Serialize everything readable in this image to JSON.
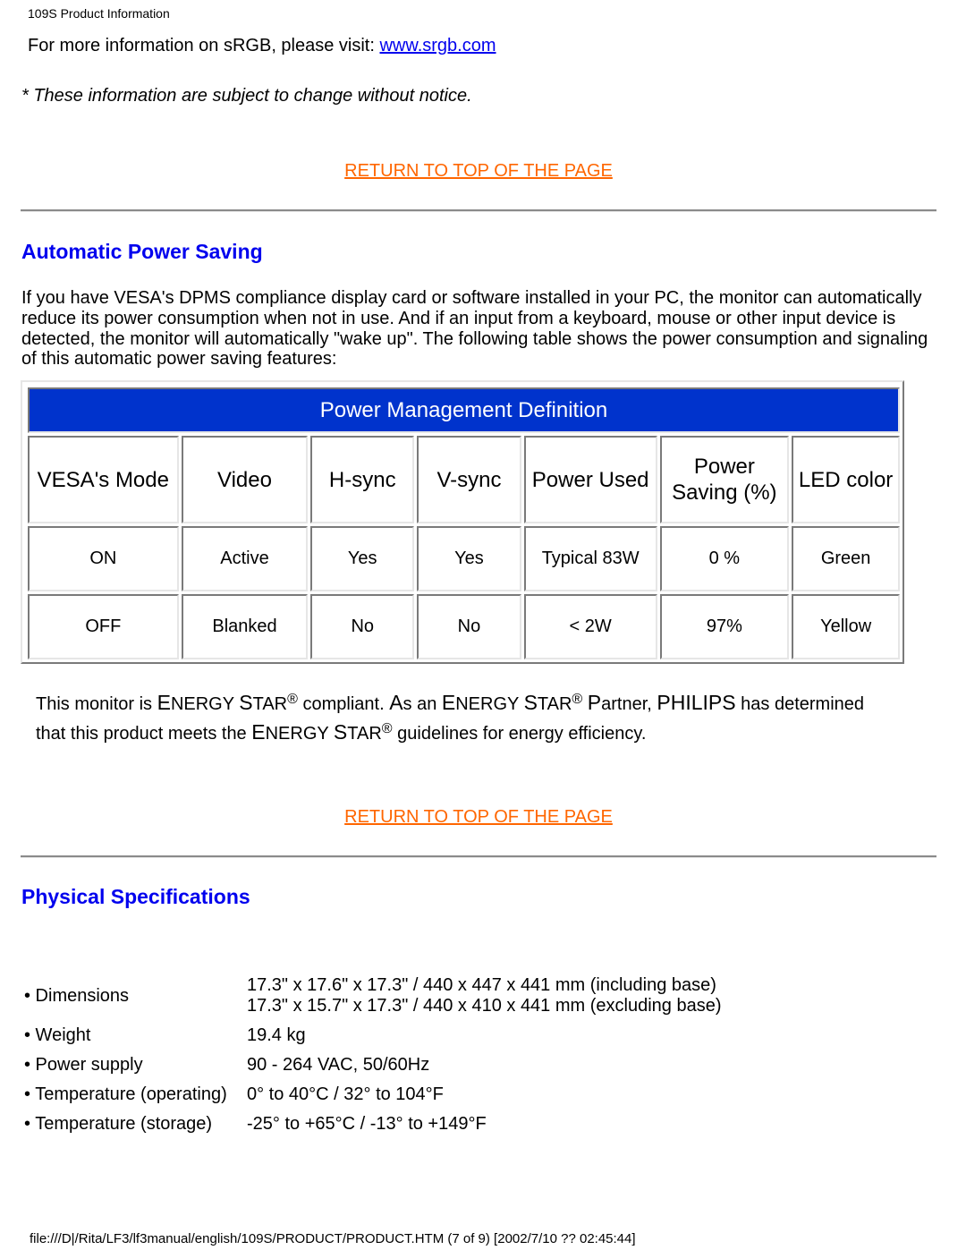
{
  "page_header": "109S Product Information",
  "srgb": {
    "text": "For more information on sRGB, please visit: ",
    "link_label": "www.srgb.com"
  },
  "notice": "* These information are subject to change without notice.",
  "return_to_top_label": "RETURN TO TOP OF THE PAGE",
  "power_saving": {
    "title": "Automatic Power Saving",
    "intro": "If you have VESA's DPMS compliance display card or software installed in your PC, the monitor can automatically reduce its power consumption when not in use. And if an input from a keyboard, mouse or other input device is detected, the monitor will automatically \"wake up\". The following table shows the power consumption and signaling of this automatic power saving features:",
    "table": {
      "title": "Power Management Definition",
      "title_bg_color": "#0033cc",
      "headers": [
        "VESA's Mode",
        "Video",
        "H-sync",
        "V-sync",
        "Power Used",
        "Power Saving (%)",
        "LED color"
      ],
      "rows": [
        [
          "ON",
          "Active",
          "Yes",
          "Yes",
          "Typical 83W",
          "0 %",
          "Green"
        ],
        [
          "OFF",
          "Blanked",
          "No",
          "No",
          "< 2W",
          "97%",
          "Yellow"
        ]
      ]
    },
    "energy_star": {
      "p1": "This monitor is ",
      "es_e": "E",
      "es_nergy": "NERGY ",
      "es_s": "S",
      "es_tar": "TAR",
      "reg": "®",
      "p2": " compliant. ",
      "as_a": "A",
      "as_rest": "s an ",
      "partner_p": "P",
      "partner_rest": "artner, ",
      "philips": "PHILIPS",
      "p3": " has determined that this product meets the ",
      "p4": " guidelines for energy efficiency."
    }
  },
  "physical": {
    "title": "Physical Specifications",
    "specs": [
      {
        "label": "• Dimensions",
        "values": [
          "17.3\" x 17.6\" x 17.3\" / 440 x 447 x 441 mm (including base)",
          "17.3\" x 15.7\" x 17.3\" / 440 x 410 x 441 mm (excluding base)"
        ]
      },
      {
        "label": "• Weight",
        "values": [
          "19.4 kg"
        ]
      },
      {
        "label": "• Power supply",
        "values": [
          "90 - 264 VAC, 50/60Hz"
        ]
      },
      {
        "label": "• Temperature (operating)",
        "values": [
          "0° to 40°C / 32° to 104°F"
        ]
      },
      {
        "label": "• Temperature (storage)",
        "values": [
          "-25° to +65°C / -13° to +149°F"
        ]
      }
    ]
  },
  "footer": "file:///D|/Rita/LF3/lf3manual/english/109S/PRODUCT/PRODUCT.HTM (7 of 9) [2002/7/10 ?? 02:45:44]"
}
